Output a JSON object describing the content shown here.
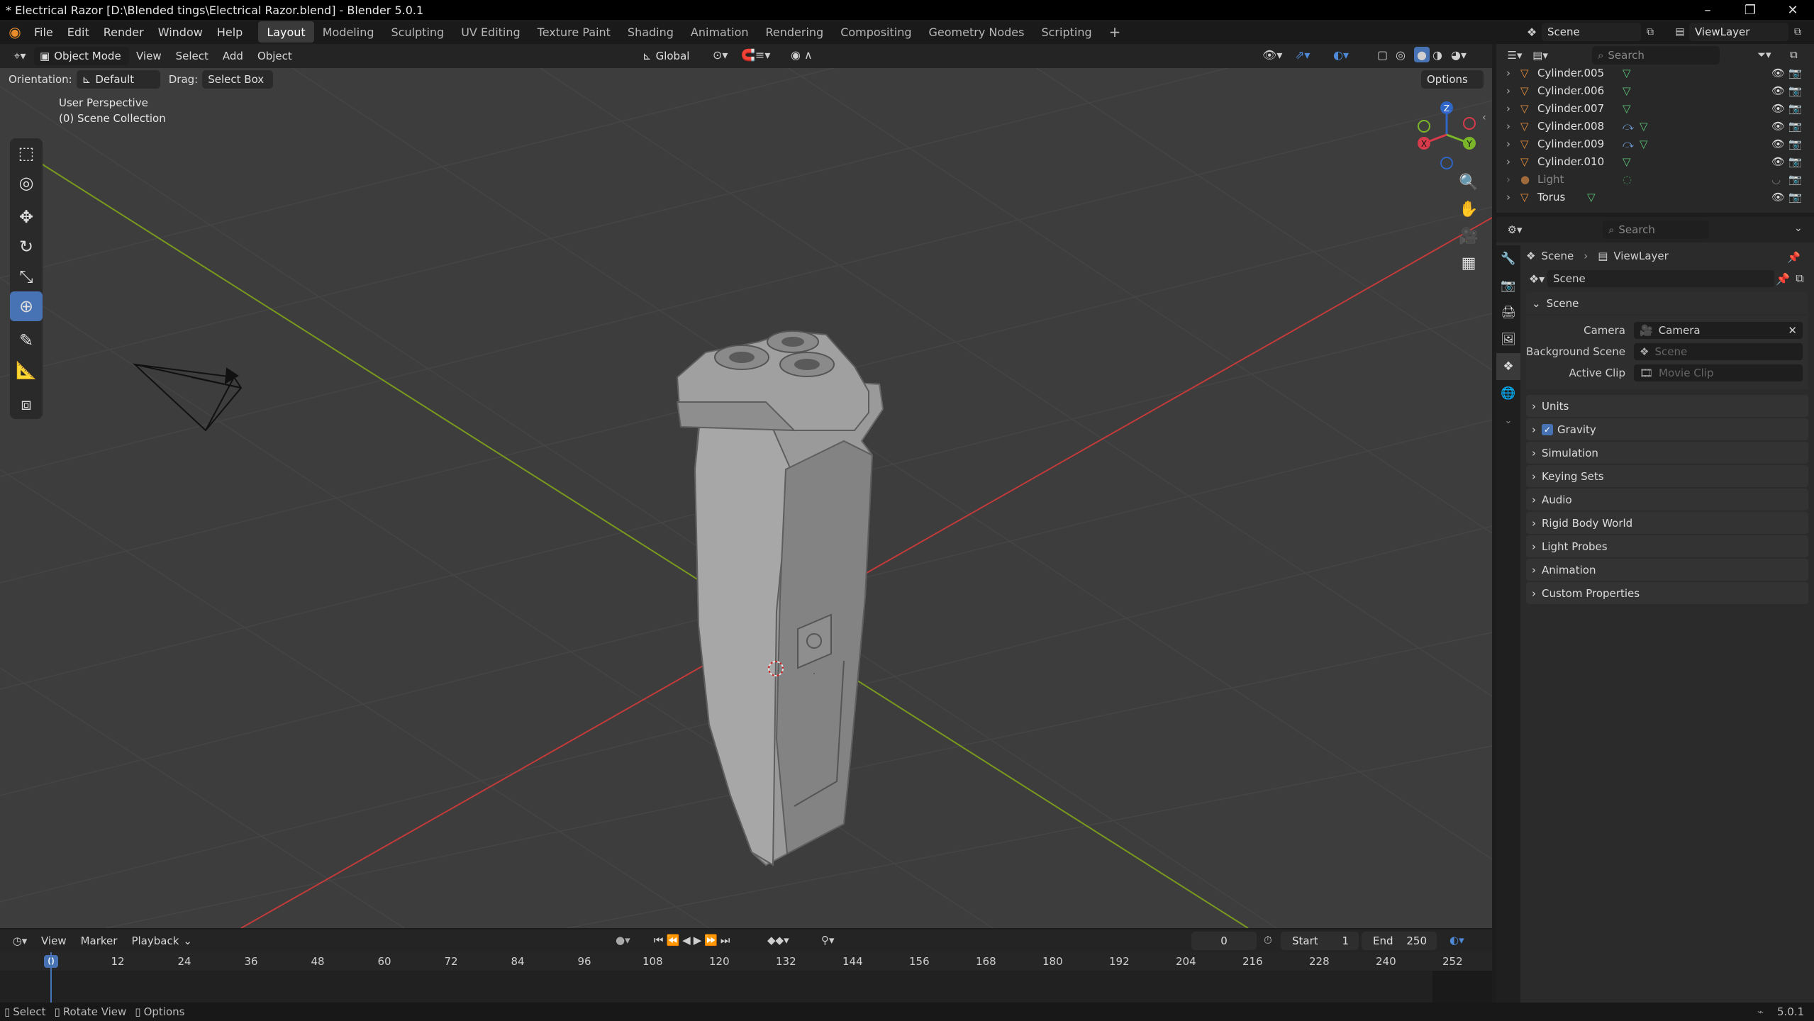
{
  "window": {
    "title": "* Electrical Razor [D:\\Blended tings\\Electrical Razor.blend] - Blender 5.0.1"
  },
  "menus": [
    "File",
    "Edit",
    "Render",
    "Window",
    "Help"
  ],
  "workspaces": [
    "Layout",
    "Modeling",
    "Sculpting",
    "UV Editing",
    "Texture Paint",
    "Shading",
    "Animation",
    "Rendering",
    "Compositing",
    "Geometry Nodes",
    "Scripting"
  ],
  "topright": {
    "scene": "Scene",
    "viewlayer": "ViewLayer"
  },
  "vpheader": {
    "mode": "Object Mode",
    "view": "View",
    "select": "Select",
    "add": "Add",
    "object": "Object",
    "transform": "Global"
  },
  "vpheader2": {
    "orientation_label": "Orientation:",
    "orientation": "Default",
    "drag_label": "Drag:",
    "drag": "Select Box",
    "options": "Options"
  },
  "viewport": {
    "perspective": "User Perspective",
    "collection": "(0) Scene Collection",
    "gizmo": {
      "z": "Z",
      "y": "Y",
      "x": "X"
    }
  },
  "outliner": {
    "search_placeholder": "Search",
    "items": [
      {
        "name": "Cylinder.005",
        "dim": false
      },
      {
        "name": "Cylinder.006",
        "dim": false
      },
      {
        "name": "Cylinder.007",
        "dim": false
      },
      {
        "name": "Cylinder.008",
        "dim": false
      },
      {
        "name": "Cylinder.009",
        "dim": false
      },
      {
        "name": "Cylinder.010",
        "dim": false
      },
      {
        "name": "Light",
        "dim": true
      },
      {
        "name": "Torus",
        "dim": false
      }
    ]
  },
  "properties": {
    "search_placeholder": "Search",
    "breadcrumb": {
      "scene": "Scene",
      "viewlayer": "ViewLayer"
    },
    "datablock": "Scene",
    "section": "Scene",
    "camera_label": "Camera",
    "camera_value": "Camera",
    "bg_label": "Background Scene",
    "bg_placeholder": "Scene",
    "clip_label": "Active Clip",
    "clip_placeholder": "Movie Clip",
    "panels": [
      "Units",
      "Gravity",
      "Simulation",
      "Keying Sets",
      "Audio",
      "Rigid Body World",
      "Light Probes",
      "Animation",
      "Custom Properties"
    ]
  },
  "timeline": {
    "view": "View",
    "marker": "Marker",
    "playback": "Playback",
    "current": "0",
    "start_label": "Start",
    "start": "1",
    "end_label": "End",
    "end": "250",
    "ticks": [
      "0",
      "12",
      "24",
      "36",
      "48",
      "60",
      "72",
      "84",
      "96",
      "108",
      "120",
      "132",
      "144",
      "156",
      "168",
      "180",
      "192",
      "204",
      "216",
      "228",
      "240",
      "252"
    ]
  },
  "status": {
    "select": "Select",
    "rotate": "Rotate View",
    "options": "Options",
    "version": "5.0.1"
  },
  "colors": {
    "accent": "#4772b3",
    "xaxis": "#c23a3a",
    "yaxis": "#7a9a1e",
    "frame": "#4772b3"
  }
}
